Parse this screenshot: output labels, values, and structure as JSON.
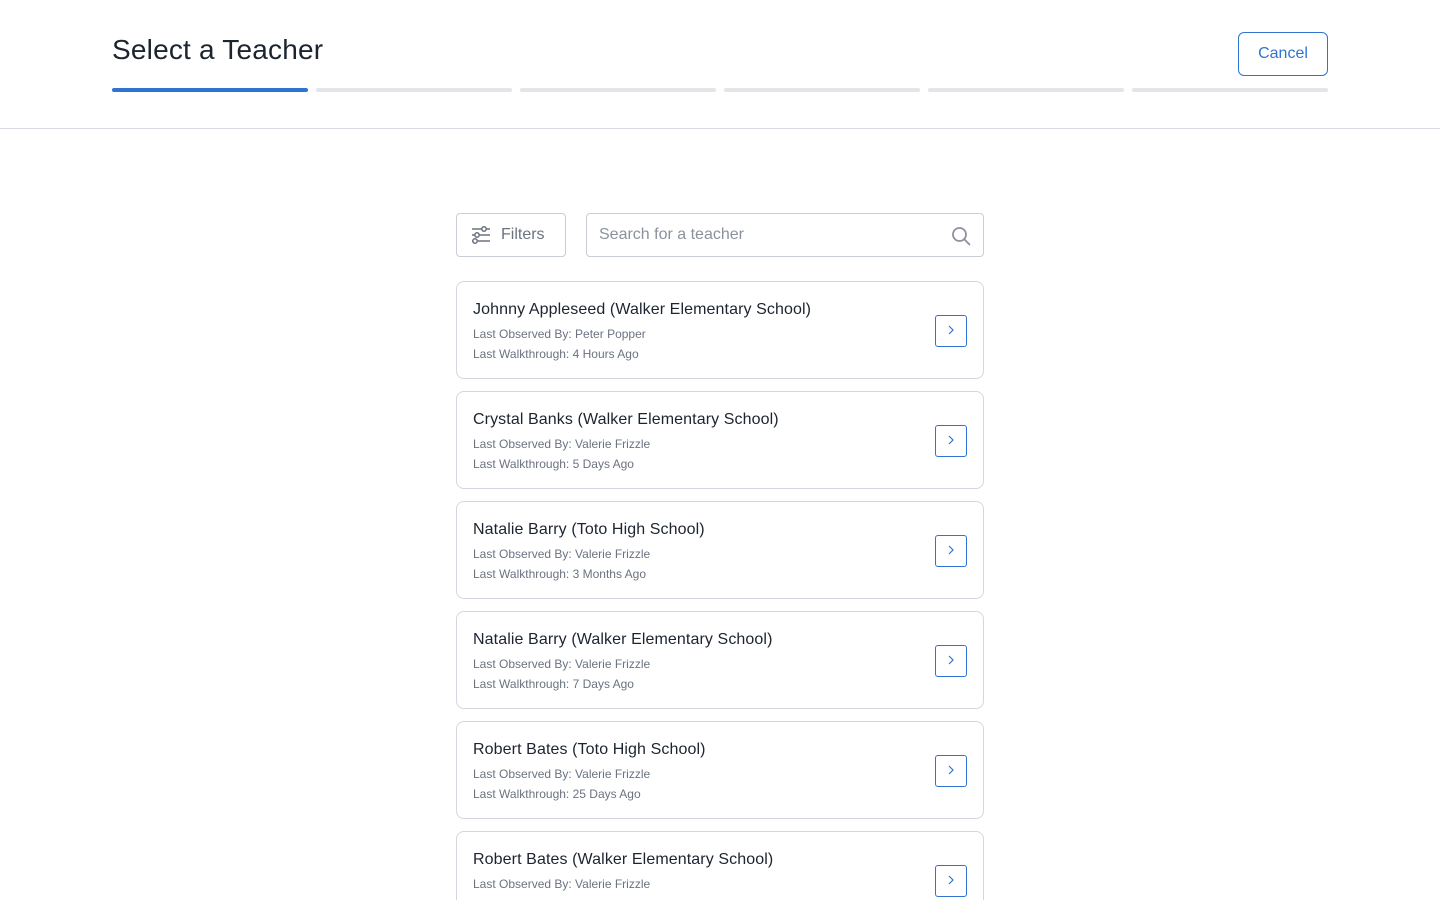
{
  "header": {
    "title": "Select a Teacher",
    "cancel_label": "Cancel",
    "progress": {
      "total_steps": 6,
      "current_step": 1
    }
  },
  "toolbar": {
    "filters_label": "Filters",
    "search_placeholder": "Search for a teacher",
    "search_value": ""
  },
  "colors": {
    "accent": "#2f74d0",
    "border": "#d3d7dd",
    "muted_text": "#6b7380"
  },
  "teachers": [
    {
      "name": "Johnny Appleseed (Walker Elementary School)",
      "observed_by": "Last Observed By: Peter Popper",
      "walkthrough": "Last Walkthrough: 4 Hours Ago"
    },
    {
      "name": "Crystal Banks (Walker Elementary School)",
      "observed_by": "Last Observed By: Valerie Frizzle",
      "walkthrough": "Last Walkthrough: 5 Days Ago"
    },
    {
      "name": "Natalie Barry (Toto High School)",
      "observed_by": "Last Observed By: Valerie Frizzle",
      "walkthrough": "Last Walkthrough: 3 Months Ago"
    },
    {
      "name": "Natalie Barry (Walker Elementary School)",
      "observed_by": "Last Observed By: Valerie Frizzle",
      "walkthrough": "Last Walkthrough: 7 Days Ago"
    },
    {
      "name": "Robert Bates (Toto High School)",
      "observed_by": "Last Observed By: Valerie Frizzle",
      "walkthrough": "Last Walkthrough: 25 Days Ago"
    },
    {
      "name": "Robert Bates (Walker Elementary School)",
      "observed_by": "Last Observed By: Valerie Frizzle",
      "walkthrough": ""
    }
  ],
  "icons": {
    "filters": "sliders-icon",
    "search": "search-icon",
    "row_action": "chevron-right-icon"
  }
}
